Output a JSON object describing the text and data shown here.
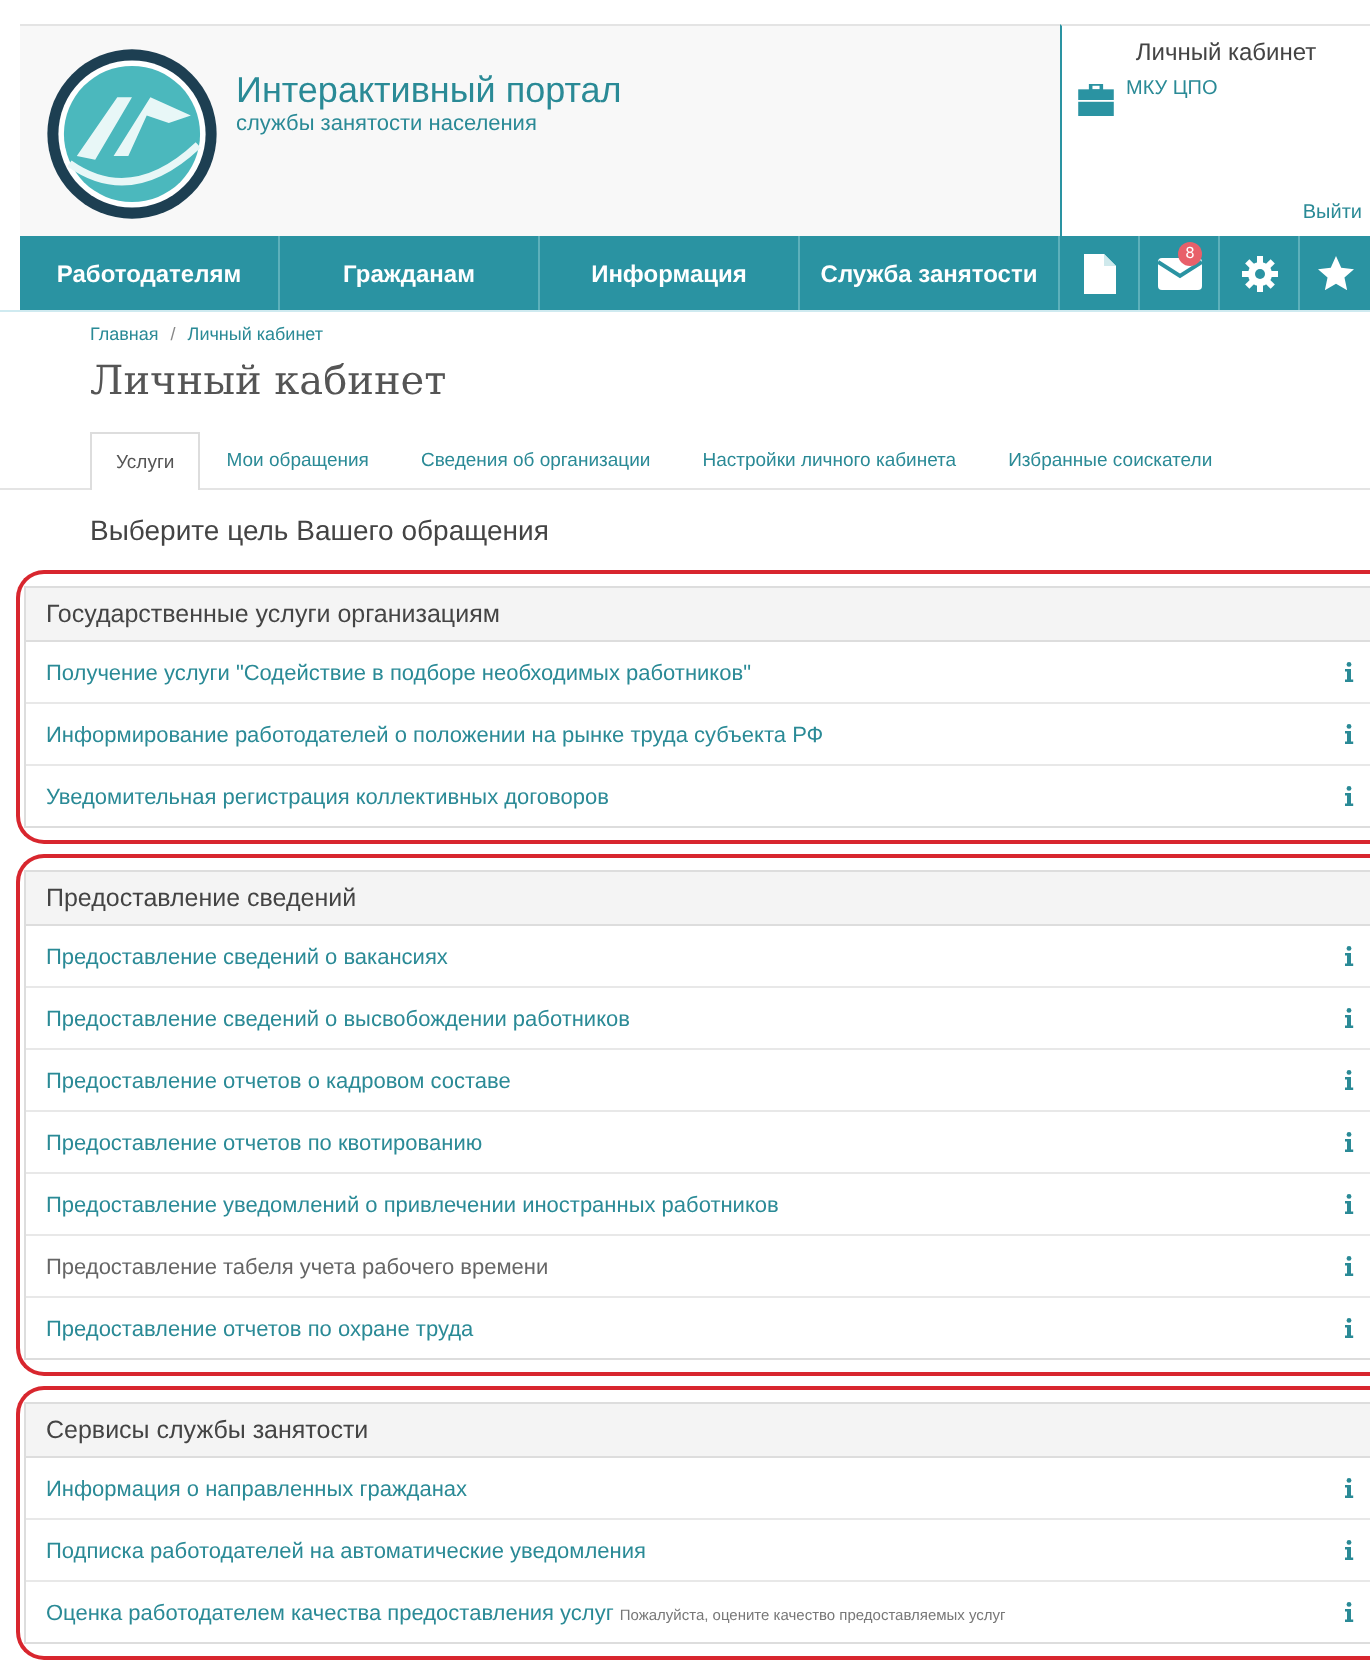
{
  "header": {
    "title": "Интерактивный портал",
    "subtitle": "службы занятости населения"
  },
  "account": {
    "title": "Личный кабинет",
    "org": "МКУ ЦПО",
    "logout": "Выйти"
  },
  "nav": {
    "items": [
      "Работодателям",
      "Гражданам",
      "Информация",
      "Служба занятости"
    ],
    "icons": [
      {
        "kind": "document"
      },
      {
        "kind": "mail",
        "badge": "8"
      },
      {
        "kind": "settings"
      },
      {
        "kind": "star"
      }
    ]
  },
  "breadcrumb": {
    "items": [
      "Главная",
      "Личный кабинет"
    ],
    "separator": "/"
  },
  "page_title": "Личный кабинет",
  "tabs": [
    {
      "label": "Услуги",
      "selected": true
    },
    {
      "label": "Мои обращения",
      "selected": false
    },
    {
      "label": "Сведения об организации",
      "selected": false
    },
    {
      "label": "Настройки личного кабинета",
      "selected": false
    },
    {
      "label": "Избранные соискатели",
      "selected": false
    }
  ],
  "prompt": "Выберите цель Вашего обращения",
  "groups": [
    {
      "title": "Государственные услуги организациям",
      "items": [
        {
          "label": "Получение услуги \"Содействие в подборе необходимых работников\"",
          "disabled": false
        },
        {
          "label": "Информирование работодателей о положении на рынке труда субъекта РФ",
          "disabled": false
        },
        {
          "label": "Уведомительная регистрация коллективных договоров",
          "disabled": false
        }
      ]
    },
    {
      "title": "Предоставление сведений",
      "items": [
        {
          "label": "Предоставление сведений о вакансиях",
          "disabled": false
        },
        {
          "label": "Предоставление сведений о высвобождении работников",
          "disabled": false
        },
        {
          "label": "Предоставление отчетов о кадровом составе",
          "disabled": false
        },
        {
          "label": "Предоставление отчетов по квотированию",
          "disabled": false
        },
        {
          "label": "Предоставление уведомлений о привлечении иностранных работников",
          "disabled": false
        },
        {
          "label": "Предоставление табеля учета рабочего времени",
          "disabled": true
        },
        {
          "label": "Предоставление отчетов по охране труда",
          "disabled": false
        }
      ]
    },
    {
      "title": "Сервисы службы занятости",
      "items": [
        {
          "label": "Информация о направленных гражданах",
          "disabled": false
        },
        {
          "label": "Подписка работодателей на автоматические уведомления",
          "disabled": false
        },
        {
          "label": "Оценка работодателем качества предоставления услуг",
          "note": "Пожалуйста, оцените качество предоставляемых услуг",
          "disabled": false
        }
      ]
    }
  ]
}
